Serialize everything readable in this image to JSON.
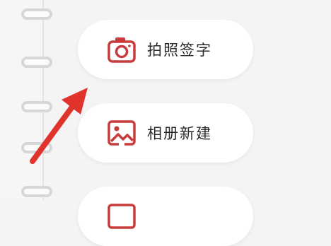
{
  "menu": {
    "items": [
      {
        "label": "拍照签字",
        "icon": "camera-icon"
      },
      {
        "label": "相册新建",
        "icon": "gallery-icon"
      },
      {
        "label": "",
        "icon": "document-icon"
      }
    ]
  },
  "colors": {
    "accent": "#c83b3b",
    "arrow": "#e0332b"
  }
}
